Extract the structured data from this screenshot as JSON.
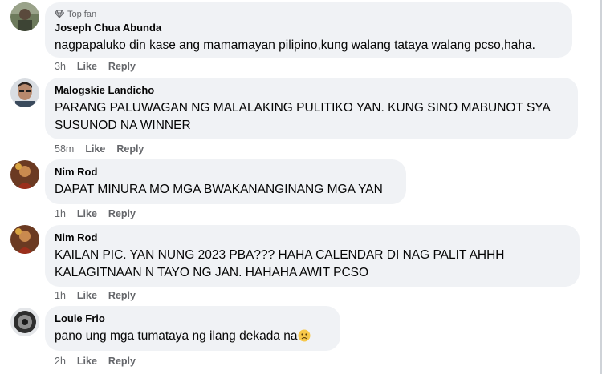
{
  "comments": [
    {
      "badge": "Top fan",
      "badge_icon": "diamond-icon",
      "name": "Joseph Chua Abunda",
      "text": "nagpapaluko din kase ang mamamayan pilipino,kung walang tataya walang pcso,haha.",
      "time": "3h",
      "like": "Like",
      "reply": "Reply"
    },
    {
      "name": "Malogskie Landicho",
      "text": "PARANG PALUWAGAN NG MALALAKING PULITIKO YAN. KUNG SINO MABUNOT SYA SUSUNOD NA WINNER",
      "time": "58m",
      "like": "Like",
      "reply": "Reply"
    },
    {
      "name": "Nim Rod",
      "text": "DAPAT MINURA MO MGA BWAKANANGINANG MGA YAN",
      "time": "1h",
      "like": "Like",
      "reply": "Reply"
    },
    {
      "name": "Nim Rod",
      "text": "KAILAN PIC. YAN NUNG 2023 PBA??? HAHA CALENDAR DI NAG PALIT AHHH KALAGITNAAN N TAYO NG JAN. HAHAHA AWIT PCSO",
      "time": "1h",
      "like": "Like",
      "reply": "Reply"
    },
    {
      "name": "Louie Frio",
      "text": "pano ung mga tumataya ng ilang dekada na",
      "emoji": "sad-face-emoji",
      "time": "2h",
      "like": "Like",
      "reply": "Reply"
    }
  ]
}
